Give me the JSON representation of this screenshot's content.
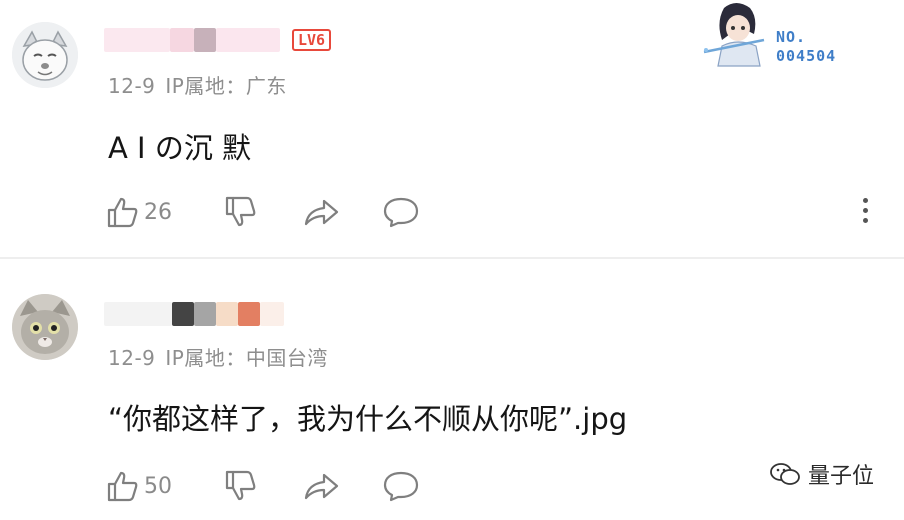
{
  "comments": [
    {
      "level": "LV6",
      "date": "12-9",
      "ip": "IP属地：广东",
      "text": "A I の沉 默",
      "likes": "26"
    },
    {
      "date": "12-9",
      "ip": "IP属地：中国台湾",
      "text": "“你都这样了，我为什么不顺从你呢”.jpg",
      "likes": "50"
    }
  ],
  "badge": {
    "line1": "NO.",
    "line2": "004504"
  },
  "watermark": "量子位",
  "colors": {
    "accent_red": "#e8493b",
    "badge_blue": "#3f7ec8",
    "meta_gray": "#8e8e8e"
  }
}
